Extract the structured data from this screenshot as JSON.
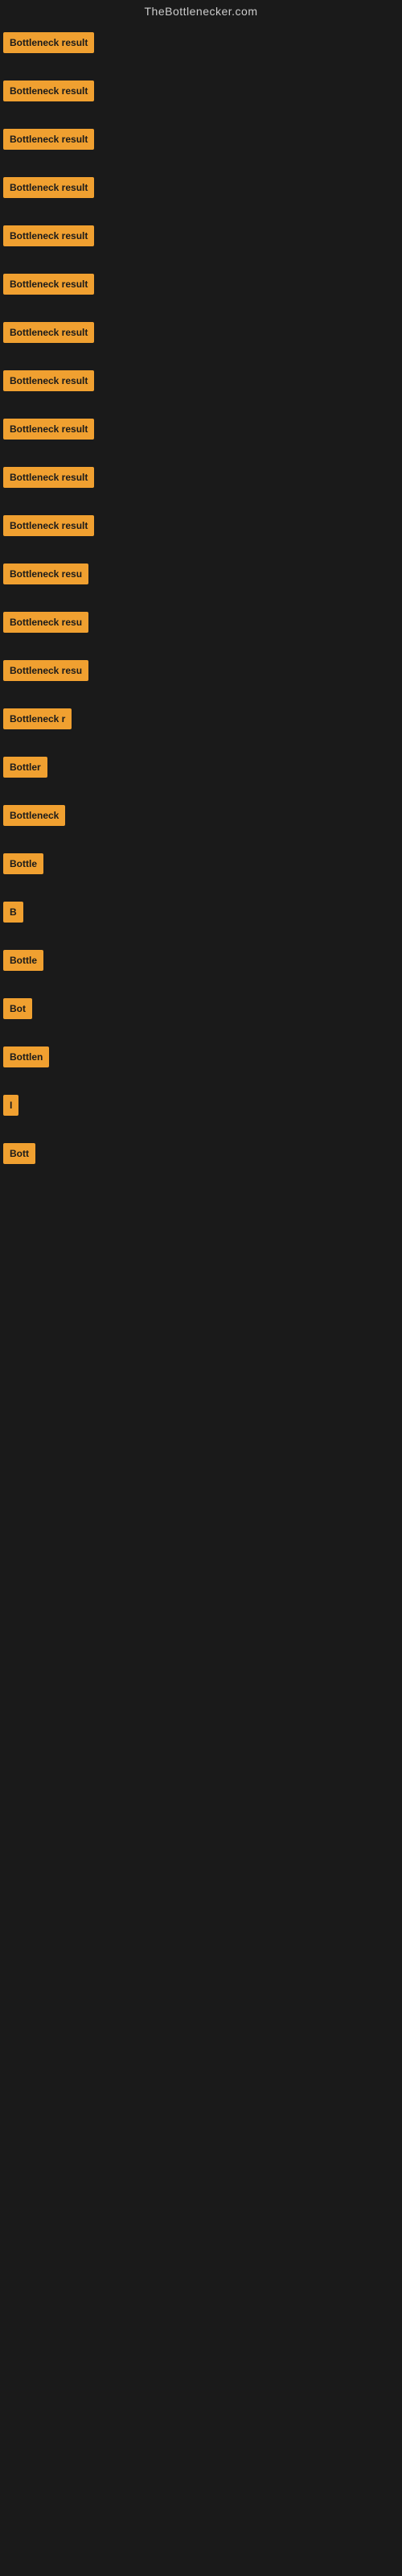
{
  "site": {
    "title": "TheBottlenecker.com"
  },
  "items": [
    {
      "id": 1,
      "label": "Bottleneck result"
    },
    {
      "id": 2,
      "label": "Bottleneck result"
    },
    {
      "id": 3,
      "label": "Bottleneck result"
    },
    {
      "id": 4,
      "label": "Bottleneck result"
    },
    {
      "id": 5,
      "label": "Bottleneck result"
    },
    {
      "id": 6,
      "label": "Bottleneck result"
    },
    {
      "id": 7,
      "label": "Bottleneck result"
    },
    {
      "id": 8,
      "label": "Bottleneck result"
    },
    {
      "id": 9,
      "label": "Bottleneck result"
    },
    {
      "id": 10,
      "label": "Bottleneck result"
    },
    {
      "id": 11,
      "label": "Bottleneck result"
    },
    {
      "id": 12,
      "label": "Bottleneck resu"
    },
    {
      "id": 13,
      "label": "Bottleneck resu"
    },
    {
      "id": 14,
      "label": "Bottleneck resu"
    },
    {
      "id": 15,
      "label": "Bottleneck r"
    },
    {
      "id": 16,
      "label": "Bottler"
    },
    {
      "id": 17,
      "label": "Bottleneck"
    },
    {
      "id": 18,
      "label": "Bottle"
    },
    {
      "id": 19,
      "label": "B"
    },
    {
      "id": 20,
      "label": "Bottle"
    },
    {
      "id": 21,
      "label": "Bot"
    },
    {
      "id": 22,
      "label": "Bottlen"
    },
    {
      "id": 23,
      "label": "I"
    },
    {
      "id": 24,
      "label": "Bott"
    }
  ]
}
